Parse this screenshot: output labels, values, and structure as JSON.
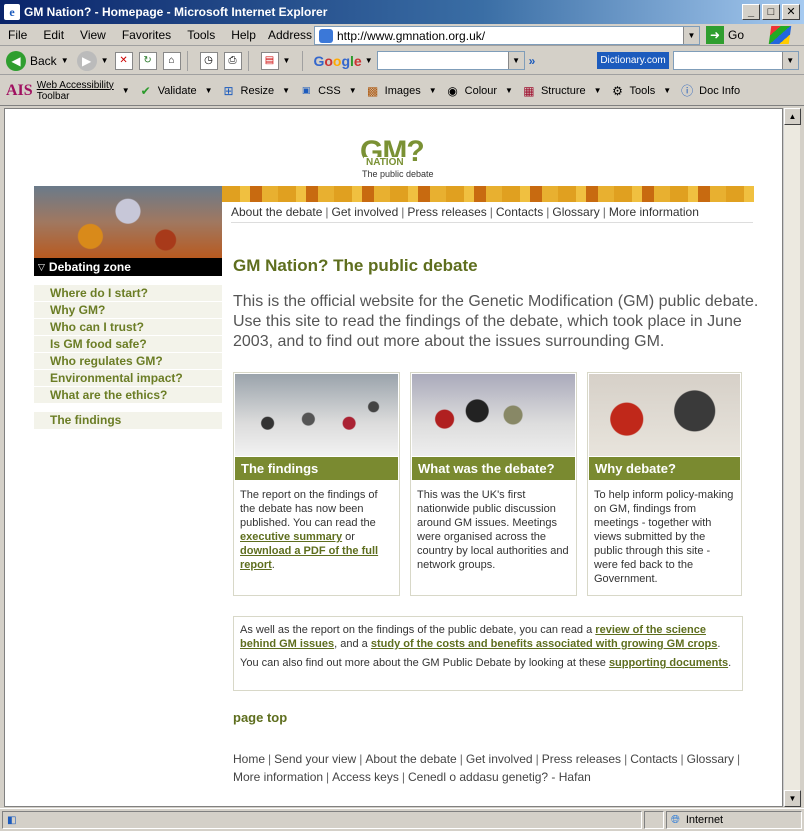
{
  "window": {
    "title": "GM Nation? - Homepage - Microsoft Internet Explorer"
  },
  "menu": [
    "File",
    "Edit",
    "View",
    "Favorites",
    "Tools",
    "Help"
  ],
  "address": {
    "label": "Address",
    "url": "http://www.gmnation.org.uk/",
    "go_label": "Go"
  },
  "toolbar1": {
    "back_label": "Back",
    "google_label": "Google",
    "dictionary_label": "Dictionary.com"
  },
  "toolbar2": {
    "ais": "AIS",
    "ais_line1": "Web Accessibility",
    "ais_line2": "Toolbar",
    "items": [
      "Validate",
      "Resize",
      "CSS",
      "Images",
      "Colour",
      "Structure",
      "Tools",
      "Doc Info"
    ]
  },
  "site": {
    "logo_main": "GM?",
    "logo_sub": "NATION",
    "logo_tag": "The public debate",
    "topnav": [
      "About the debate",
      "Get involved",
      "Press releases",
      "Contacts",
      "Glossary",
      "More information"
    ],
    "zone_title": "Debating zone",
    "zone_items": [
      "Where do I start?",
      "Why GM?",
      "Who can I trust?",
      "Is GM food safe?",
      "Who regulates GM?",
      "Environmental impact?",
      "What are the ethics?"
    ],
    "findings_link": "The findings",
    "page_title": "GM Nation? The public debate",
    "intro": "This is the official website for the Genetic Modification (GM) public debate. Use this site to read the findings of the debate, which took place in June 2003, and to find out more about the issues surrounding GM.",
    "cards": [
      {
        "title": "The findings",
        "text_a": "The report on the findings of the debate has now been published. You can read the ",
        "link_a": "executive summary",
        "text_b": " or ",
        "link_b": "download a PDF of the full report",
        "text_c": "."
      },
      {
        "title": "What was the debate?",
        "text": "This was the UK's first nationwide public discussion around GM issues. Meetings were organised across the country by local authorities and network groups."
      },
      {
        "title": "Why debate?",
        "text": "To help inform policy-making on GM, findings from meetings - together with views submitted by the public through this site - were fed back to the Government."
      }
    ],
    "info": {
      "p1_a": "As well as the report on the findings of the public debate, you can read a ",
      "p1_link1": "review of the science behind GM issues",
      "p1_b": ", and a ",
      "p1_link2": "study of the costs and benefits associated with growing GM crops",
      "p1_c": ".",
      "p2_a": "You can also find out more about the GM Public Debate by looking at these ",
      "p2_link": "supporting documents",
      "p2_b": "."
    },
    "page_top": "page top",
    "bottom_nav": [
      "Home",
      "Send your view",
      "About the debate",
      "Get involved",
      "Press releases",
      "Contacts",
      "Glossary",
      "More information",
      "Access keys",
      "Cenedl o addasu genetig? - Hafan"
    ]
  },
  "status": {
    "zone": "Internet"
  }
}
